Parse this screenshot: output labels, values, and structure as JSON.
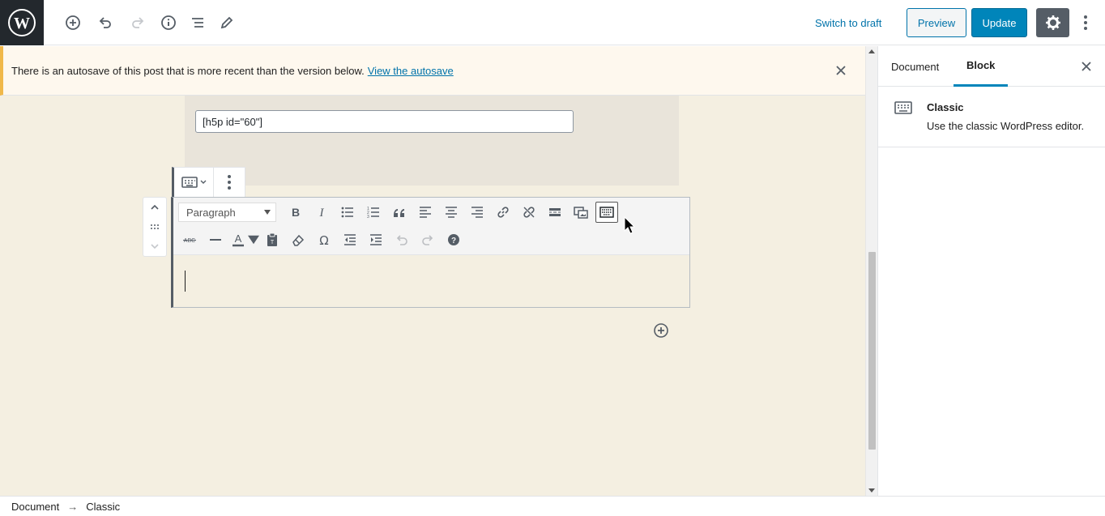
{
  "topbar": {
    "switch_to_draft": "Switch to draft",
    "preview": "Preview",
    "update": "Update",
    "icons": [
      "wordpress-logo",
      "add-block-icon",
      "undo-icon",
      "redo-icon",
      "info-icon",
      "outline-icon",
      "edit-icon",
      "settings-gear-icon",
      "more-vertical-icon"
    ]
  },
  "notice": {
    "text": "There is an autosave of this post that is more recent than the version below.",
    "link": "View the autosave"
  },
  "shortcode": {
    "value": "[h5p id=\"60\"]"
  },
  "classic": {
    "format_select": "Paragraph"
  },
  "sidebar": {
    "tab_document": "Document",
    "tab_block": "Block",
    "active_tab": "Block",
    "block_title": "Classic",
    "block_description": "Use the classic WordPress editor."
  },
  "breadcrumb": {
    "items": [
      "Document",
      "Classic"
    ],
    "separator": "→"
  },
  "colors": {
    "accent": "#0085ba",
    "link": "#0073aa",
    "editor_bg": "#f4efe1",
    "notice_bg": "#fef8ee"
  }
}
